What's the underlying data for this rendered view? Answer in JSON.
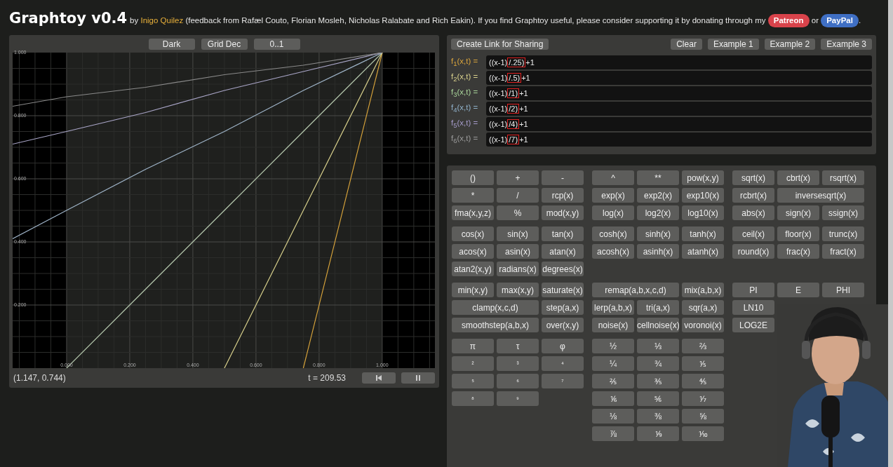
{
  "header": {
    "title": "Graphtoy v0.4",
    "credits": [
      {
        "kind": "text",
        "text": "by "
      },
      {
        "kind": "link",
        "text": "Inigo Quilez"
      },
      {
        "kind": "text",
        "text": " (feedback from Rafæl Couto, Florian Mosleh, Nicholas Ralabate and Rich Eakin). If you find Graphtoy useful, please consider supporting it by donating through my "
      },
      {
        "kind": "pill",
        "text": "Patreon",
        "color": "#d9434b"
      },
      {
        "kind": "text",
        "text": " or "
      },
      {
        "kind": "pill",
        "text": "PayPal",
        "color": "#3f6fc4"
      },
      {
        "kind": "text",
        "text": "."
      }
    ]
  },
  "plot": {
    "toolbar": [
      "Dark",
      "Grid Dec",
      "0..1"
    ],
    "chart_data": {
      "type": "line",
      "grid": true,
      "x": [
        -0.171,
        0,
        0.25,
        0.5,
        0.75,
        1
      ],
      "xlim": [
        -0.171,
        1.167
      ],
      "ylim": [
        0,
        1
      ],
      "xticks": [
        {
          "value": 0,
          "label": "0.000"
        },
        {
          "value": 0.2,
          "label": "0.200"
        },
        {
          "value": 0.4,
          "label": "0.400"
        },
        {
          "value": 0.6,
          "label": "0.600"
        },
        {
          "value": 0.8,
          "label": "0.800"
        },
        {
          "value": 1,
          "label": "1.000"
        }
      ],
      "yticks": [
        {
          "value": 0.2,
          "label": "0.200"
        },
        {
          "value": 0.4,
          "label": "0.400"
        },
        {
          "value": 0.6,
          "label": "0.600"
        },
        {
          "value": 0.8,
          "label": "0.800"
        },
        {
          "value": 1,
          "label": "1.000"
        }
      ],
      "series": [
        {
          "color": "#d9a43c",
          "values": [
            null,
            null,
            null,
            null,
            0,
            1
          ]
        },
        {
          "color": "#d8d08c",
          "values": [
            null,
            null,
            null,
            0,
            0.5,
            1
          ]
        },
        {
          "color": "#b8cbb0",
          "values": [
            null,
            0,
            0.25,
            0.5,
            0.75,
            1
          ]
        },
        {
          "color": "#9fb4c8",
          "values": [
            0.41,
            0.5,
            0.63,
            0.75,
            0.88,
            1
          ]
        },
        {
          "color": "#aaa6c8",
          "values": [
            0.71,
            0.75,
            0.81,
            0.88,
            0.94,
            1
          ]
        },
        {
          "color": "#8a8a8a",
          "values": [
            0.83,
            0.86,
            0.89,
            0.93,
            0.96,
            1
          ]
        }
      ]
    },
    "coordinates": "(1.147, 0.744)",
    "time": "t = 209.53"
  },
  "actions": {
    "share": "Create Link for Sharing",
    "buttons": [
      "Clear",
      "Example 1",
      "Example 2",
      "Example 3"
    ]
  },
  "functions": [
    {
      "label": "f$_{1}$(x,t) =",
      "color": "#d9a43c",
      "before": "((x-1)",
      "boxed": "/.25)",
      "after": "+1"
    },
    {
      "label": "f$_{2}$(x,t) =",
      "color": "#d8d08c",
      "before": "((x-1)",
      "boxed": "/.5)",
      "after": "+1"
    },
    {
      "label": "f$_{3}$(x,t) =",
      "color": "#a9d49a",
      "before": "((x-1)",
      "boxed": "/1)",
      "after": "+1"
    },
    {
      "label": "f$_{4}$(x,t) =",
      "color": "#8fb0c8",
      "before": "((x-1)",
      "boxed": "/2)",
      "after": "+1"
    },
    {
      "label": "f$_{5}$(x,t) =",
      "color": "#a49ac8",
      "before": "((x-1)",
      "boxed": "/4)",
      "after": "+1"
    },
    {
      "label": "f$_{6}$(x,t) =",
      "color": "#9a9a9a",
      "before": "((x-1)",
      "boxed": "/7)",
      "after": "+1"
    }
  ],
  "keypad": [
    {
      "groups": [
        [
          {
            "label": "()"
          },
          {
            "label": "+"
          },
          {
            "label": "-"
          },
          {
            "label": "*"
          },
          {
            "label": "/"
          },
          {
            "label": "rcp(x)"
          },
          {
            "label": "fma(x,y,z)"
          },
          {
            "label": "%"
          },
          {
            "label": "mod(x,y)"
          }
        ],
        [
          {
            "label": "^"
          },
          {
            "label": "**"
          },
          {
            "label": "pow(x,y)"
          },
          {
            "label": "exp(x)"
          },
          {
            "label": "exp2(x)"
          },
          {
            "label": "exp10(x)"
          },
          {
            "label": "log(x)"
          },
          {
            "label": "log2(x)"
          },
          {
            "label": "log10(x)"
          }
        ],
        [
          {
            "label": "sqrt(x)"
          },
          {
            "label": "cbrt(x)"
          },
          {
            "label": "rsqrt(x)"
          },
          {
            "label": "rcbrt(x)"
          },
          {
            "label": "inversesqrt(x)",
            "kind": "wide"
          },
          {
            "label": "abs(x)"
          },
          {
            "label": "sign(x)"
          },
          {
            "label": "ssign(x)"
          }
        ]
      ]
    },
    {
      "groups": [
        [
          {
            "label": "cos(x)"
          },
          {
            "label": "sin(x)"
          },
          {
            "label": "tan(x)"
          },
          {
            "label": "acos(x)"
          },
          {
            "label": "asin(x)"
          },
          {
            "label": "atan(x)"
          },
          {
            "label": "atan2(x,y)"
          },
          {
            "label": "radians(x)"
          },
          {
            "label": "degrees(x)"
          }
        ],
        [
          {
            "label": "cosh(x)"
          },
          {
            "label": "sinh(x)"
          },
          {
            "label": "tanh(x)"
          },
          {
            "label": "acosh(x)"
          },
          {
            "label": "asinh(x)"
          },
          {
            "label": "atanh(x)"
          }
        ],
        [
          {
            "label": "ceil(x)"
          },
          {
            "label": "floor(x)"
          },
          {
            "label": "trunc(x)"
          },
          {
            "label": "round(x)"
          },
          {
            "label": "frac(x)"
          },
          {
            "label": "fract(x)"
          }
        ]
      ]
    },
    {
      "groups": [
        [
          {
            "label": "min(x,y)"
          },
          {
            "label": "max(x,y)"
          },
          {
            "label": "saturate(x)"
          },
          {
            "label": "clamp(x,c,d)",
            "kind": "wide"
          },
          {
            "label": "step(a,x)"
          },
          {
            "label": "smoothstep(a,b,x)",
            "kind": "wide"
          },
          {
            "label": "over(x,y)"
          }
        ],
        [
          {
            "label": "remap(a,b,x,c,d)",
            "kind": "wide"
          },
          {
            "label": "mix(a,b,x)"
          },
          {
            "label": "lerp(a,b,x)"
          },
          {
            "label": "tri(a,x)"
          },
          {
            "label": "sqr(a,x)"
          },
          {
            "label": "noise(x)"
          },
          {
            "label": "cellnoise(x)"
          },
          {
            "label": "voronoi(x)"
          }
        ],
        [
          {
            "label": "PI"
          },
          {
            "label": "E"
          },
          {
            "label": "PHI"
          },
          {
            "label": "LN10",
            "kind": "first"
          },
          {
            "label": "LOG2E",
            "kind": "first"
          }
        ]
      ]
    },
    {
      "groups": [
        [
          {
            "label": "π"
          },
          {
            "label": "τ"
          },
          {
            "label": "φ"
          },
          {
            "label": "²",
            "kind": "small"
          },
          {
            "label": "³",
            "kind": "small"
          },
          {
            "label": "⁴",
            "kind": "small"
          },
          {
            "label": "⁵",
            "kind": "small"
          },
          {
            "label": "⁶",
            "kind": "small"
          },
          {
            "label": "⁷",
            "kind": "small"
          },
          {
            "label": "⁸",
            "kind": "small"
          },
          {
            "label": "⁹",
            "kind": "small"
          }
        ],
        [
          {
            "label": "½"
          },
          {
            "label": "⅓"
          },
          {
            "label": "⅔"
          },
          {
            "label": "¼"
          },
          {
            "label": "¾"
          },
          {
            "label": "⅕"
          },
          {
            "label": "⅖"
          },
          {
            "label": "⅗"
          },
          {
            "label": "⅘"
          },
          {
            "label": "⅙"
          },
          {
            "label": "⅚"
          },
          {
            "label": "⅐"
          },
          {
            "label": "⅛"
          },
          {
            "label": "⅜"
          },
          {
            "label": "⅝"
          },
          {
            "label": "⅞"
          },
          {
            "label": "⅑"
          },
          {
            "label": "⅒"
          }
        ]
      ]
    }
  ]
}
